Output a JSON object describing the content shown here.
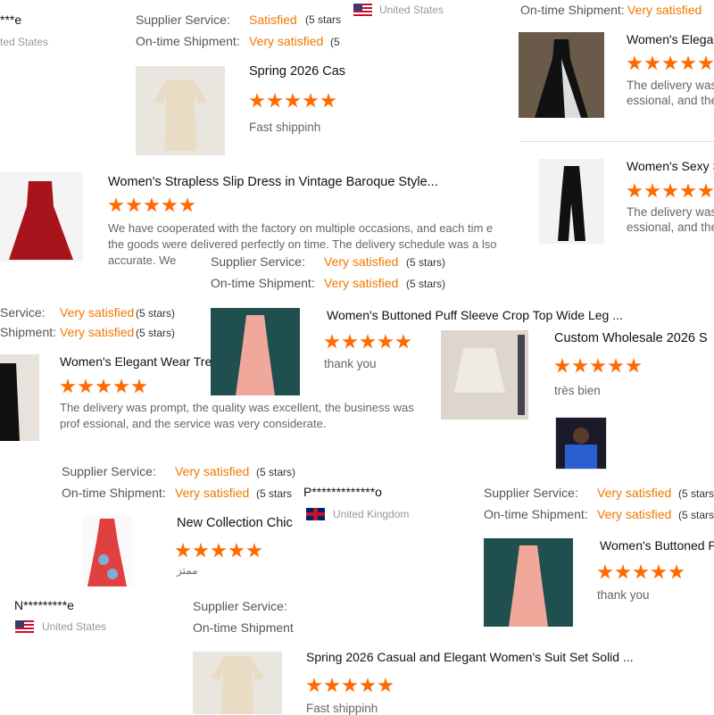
{
  "labels": {
    "supplier_service": "Supplier Service:",
    "ontime_shipment": "On-time Shipment:",
    "ontime_shipment_nocolon": "On-time Shipment",
    "supplier_service_clipped": "Service:",
    "ontime_shipment_clipped": "Shipment:"
  },
  "ratings": {
    "satisfied": "Satisfied",
    "very_satisfied": "Very satisfied",
    "five_stars": "(5 stars)",
    "five_stars_clip1": "(5 stars",
    "five_stars_clip2": "(5"
  },
  "reviewers": [
    {
      "name": "***e",
      "country": "ted States"
    },
    {
      "name": "P*************o",
      "country": "United Kingdom"
    },
    {
      "name": "N*********e",
      "country": "United States"
    }
  ],
  "countries": {
    "us": "United States"
  },
  "products": [
    {
      "title": "Spring 2026 Cas",
      "comment": "Fast shippinh"
    },
    {
      "title": "Women's Elegan",
      "comment": "The delivery was",
      "comment2": "essional, and the"
    },
    {
      "title": "Women's Strapless Slip Dress in Vintage Baroque Style...",
      "comment": "We have cooperated with the factory on multiple occasions, and each tim e the goods were delivered perfectly on time. The delivery schedule was a lso accurate. We"
    },
    {
      "title": "Women's Sexy S",
      "comment": "The delivery was",
      "comment2": "essional, and the"
    },
    {
      "title": "Women's Buttoned Puff Sleeve Crop Top Wide Leg ...",
      "comment": "thank you"
    },
    {
      "title": "Custom Wholesale 2026 S",
      "comment": "très bien"
    },
    {
      "title": "Women's Elegant Wear Tre",
      "comment": "The delivery was prompt, the quality was excellent, the business was prof essional, and the service was very considerate."
    },
    {
      "title": "New Collection Chic",
      "comment": "ممتز"
    },
    {
      "title": "Women's Buttoned P",
      "comment": "thank you"
    },
    {
      "title": "Spring 2026 Casual and Elegant Women's Suit Set Solid ...",
      "comment": "Fast shippinh"
    }
  ],
  "star_rating": {
    "value": 5,
    "max": 5
  }
}
